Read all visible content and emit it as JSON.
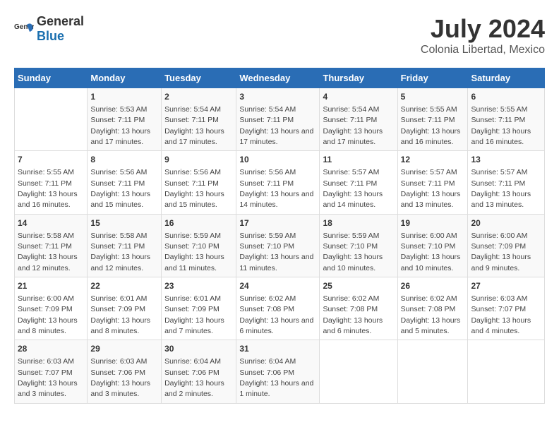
{
  "logo": {
    "general": "General",
    "blue": "Blue"
  },
  "title": "July 2024",
  "subtitle": "Colonia Libertad, Mexico",
  "days_of_week": [
    "Sunday",
    "Monday",
    "Tuesday",
    "Wednesday",
    "Thursday",
    "Friday",
    "Saturday"
  ],
  "weeks": [
    [
      {
        "day": "",
        "sunrise": "",
        "sunset": "",
        "daylight": ""
      },
      {
        "day": "1",
        "sunrise": "Sunrise: 5:53 AM",
        "sunset": "Sunset: 7:11 PM",
        "daylight": "Daylight: 13 hours and 17 minutes."
      },
      {
        "day": "2",
        "sunrise": "Sunrise: 5:54 AM",
        "sunset": "Sunset: 7:11 PM",
        "daylight": "Daylight: 13 hours and 17 minutes."
      },
      {
        "day": "3",
        "sunrise": "Sunrise: 5:54 AM",
        "sunset": "Sunset: 7:11 PM",
        "daylight": "Daylight: 13 hours and 17 minutes."
      },
      {
        "day": "4",
        "sunrise": "Sunrise: 5:54 AM",
        "sunset": "Sunset: 7:11 PM",
        "daylight": "Daylight: 13 hours and 17 minutes."
      },
      {
        "day": "5",
        "sunrise": "Sunrise: 5:55 AM",
        "sunset": "Sunset: 7:11 PM",
        "daylight": "Daylight: 13 hours and 16 minutes."
      },
      {
        "day": "6",
        "sunrise": "Sunrise: 5:55 AM",
        "sunset": "Sunset: 7:11 PM",
        "daylight": "Daylight: 13 hours and 16 minutes."
      }
    ],
    [
      {
        "day": "7",
        "sunrise": "Sunrise: 5:55 AM",
        "sunset": "Sunset: 7:11 PM",
        "daylight": "Daylight: 13 hours and 16 minutes."
      },
      {
        "day": "8",
        "sunrise": "Sunrise: 5:56 AM",
        "sunset": "Sunset: 7:11 PM",
        "daylight": "Daylight: 13 hours and 15 minutes."
      },
      {
        "day": "9",
        "sunrise": "Sunrise: 5:56 AM",
        "sunset": "Sunset: 7:11 PM",
        "daylight": "Daylight: 13 hours and 15 minutes."
      },
      {
        "day": "10",
        "sunrise": "Sunrise: 5:56 AM",
        "sunset": "Sunset: 7:11 PM",
        "daylight": "Daylight: 13 hours and 14 minutes."
      },
      {
        "day": "11",
        "sunrise": "Sunrise: 5:57 AM",
        "sunset": "Sunset: 7:11 PM",
        "daylight": "Daylight: 13 hours and 14 minutes."
      },
      {
        "day": "12",
        "sunrise": "Sunrise: 5:57 AM",
        "sunset": "Sunset: 7:11 PM",
        "daylight": "Daylight: 13 hours and 13 minutes."
      },
      {
        "day": "13",
        "sunrise": "Sunrise: 5:57 AM",
        "sunset": "Sunset: 7:11 PM",
        "daylight": "Daylight: 13 hours and 13 minutes."
      }
    ],
    [
      {
        "day": "14",
        "sunrise": "Sunrise: 5:58 AM",
        "sunset": "Sunset: 7:11 PM",
        "daylight": "Daylight: 13 hours and 12 minutes."
      },
      {
        "day": "15",
        "sunrise": "Sunrise: 5:58 AM",
        "sunset": "Sunset: 7:11 PM",
        "daylight": "Daylight: 13 hours and 12 minutes."
      },
      {
        "day": "16",
        "sunrise": "Sunrise: 5:59 AM",
        "sunset": "Sunset: 7:10 PM",
        "daylight": "Daylight: 13 hours and 11 minutes."
      },
      {
        "day": "17",
        "sunrise": "Sunrise: 5:59 AM",
        "sunset": "Sunset: 7:10 PM",
        "daylight": "Daylight: 13 hours and 11 minutes."
      },
      {
        "day": "18",
        "sunrise": "Sunrise: 5:59 AM",
        "sunset": "Sunset: 7:10 PM",
        "daylight": "Daylight: 13 hours and 10 minutes."
      },
      {
        "day": "19",
        "sunrise": "Sunrise: 6:00 AM",
        "sunset": "Sunset: 7:10 PM",
        "daylight": "Daylight: 13 hours and 10 minutes."
      },
      {
        "day": "20",
        "sunrise": "Sunrise: 6:00 AM",
        "sunset": "Sunset: 7:09 PM",
        "daylight": "Daylight: 13 hours and 9 minutes."
      }
    ],
    [
      {
        "day": "21",
        "sunrise": "Sunrise: 6:00 AM",
        "sunset": "Sunset: 7:09 PM",
        "daylight": "Daylight: 13 hours and 8 minutes."
      },
      {
        "day": "22",
        "sunrise": "Sunrise: 6:01 AM",
        "sunset": "Sunset: 7:09 PM",
        "daylight": "Daylight: 13 hours and 8 minutes."
      },
      {
        "day": "23",
        "sunrise": "Sunrise: 6:01 AM",
        "sunset": "Sunset: 7:09 PM",
        "daylight": "Daylight: 13 hours and 7 minutes."
      },
      {
        "day": "24",
        "sunrise": "Sunrise: 6:02 AM",
        "sunset": "Sunset: 7:08 PM",
        "daylight": "Daylight: 13 hours and 6 minutes."
      },
      {
        "day": "25",
        "sunrise": "Sunrise: 6:02 AM",
        "sunset": "Sunset: 7:08 PM",
        "daylight": "Daylight: 13 hours and 6 minutes."
      },
      {
        "day": "26",
        "sunrise": "Sunrise: 6:02 AM",
        "sunset": "Sunset: 7:08 PM",
        "daylight": "Daylight: 13 hours and 5 minutes."
      },
      {
        "day": "27",
        "sunrise": "Sunrise: 6:03 AM",
        "sunset": "Sunset: 7:07 PM",
        "daylight": "Daylight: 13 hours and 4 minutes."
      }
    ],
    [
      {
        "day": "28",
        "sunrise": "Sunrise: 6:03 AM",
        "sunset": "Sunset: 7:07 PM",
        "daylight": "Daylight: 13 hours and 3 minutes."
      },
      {
        "day": "29",
        "sunrise": "Sunrise: 6:03 AM",
        "sunset": "Sunset: 7:06 PM",
        "daylight": "Daylight: 13 hours and 3 minutes."
      },
      {
        "day": "30",
        "sunrise": "Sunrise: 6:04 AM",
        "sunset": "Sunset: 7:06 PM",
        "daylight": "Daylight: 13 hours and 2 minutes."
      },
      {
        "day": "31",
        "sunrise": "Sunrise: 6:04 AM",
        "sunset": "Sunset: 7:06 PM",
        "daylight": "Daylight: 13 hours and 1 minute."
      },
      {
        "day": "",
        "sunrise": "",
        "sunset": "",
        "daylight": ""
      },
      {
        "day": "",
        "sunrise": "",
        "sunset": "",
        "daylight": ""
      },
      {
        "day": "",
        "sunrise": "",
        "sunset": "",
        "daylight": ""
      }
    ]
  ]
}
